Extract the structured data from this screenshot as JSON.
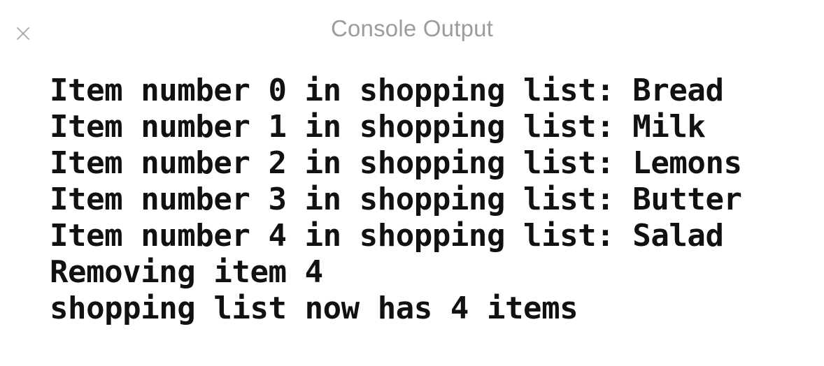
{
  "dialog": {
    "title": "Console Output",
    "close_icon": "close-icon",
    "close_label": "×",
    "title_color": "#9c9c9c",
    "background_color": "#ffffff",
    "text_color": "#111111"
  },
  "console": {
    "lines": [
      "Item number 0 in shopping list: Bread",
      "Item number 1 in shopping list: Milk",
      "Item number 2 in shopping list: Lemons",
      "Item number 3 in shopping list: Butter",
      "Item number 4 in shopping list: Salad",
      "Removing item 4",
      "shopping list now has 4 items"
    ]
  }
}
